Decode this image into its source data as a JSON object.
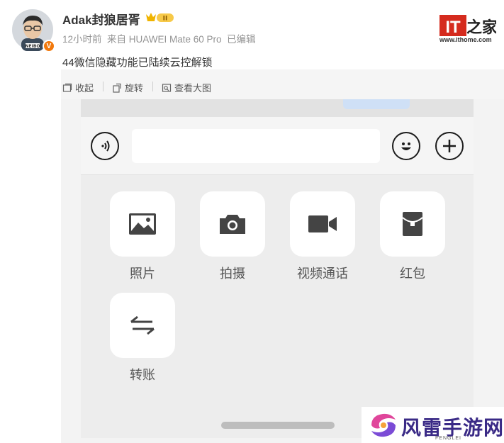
{
  "post": {
    "user_name": "Adak封狼居胥",
    "vip_badge": "II",
    "verified_mark": "V",
    "avatar_label": "NEIBO",
    "meta": "12小时前  来自 HUAWEI Mate 60 Pro  已编辑",
    "text": "44微信隐藏功能已陆续云控解锁"
  },
  "branding": {
    "logo_it": "IT",
    "logo_home": "之家",
    "logo_url": "www.ithome.com"
  },
  "toolbar": {
    "collapse": "收起",
    "rotate": "旋转",
    "view_large": "查看大图"
  },
  "chat_panel": {
    "items": [
      {
        "label": "照片",
        "icon": "photo-icon"
      },
      {
        "label": "拍摄",
        "icon": "camera-icon"
      },
      {
        "label": "视频通话",
        "icon": "video-call-icon"
      },
      {
        "label": "红包",
        "icon": "red-packet-icon"
      },
      {
        "label": "转账",
        "icon": "transfer-icon"
      }
    ]
  },
  "watermark": {
    "text": "风雷手游网",
    "sub": "FENGLEI"
  },
  "colors": {
    "accent_orange": "#f2790d",
    "ithome_red": "#d52b1e",
    "watermark_purple": "#3a2a86"
  }
}
